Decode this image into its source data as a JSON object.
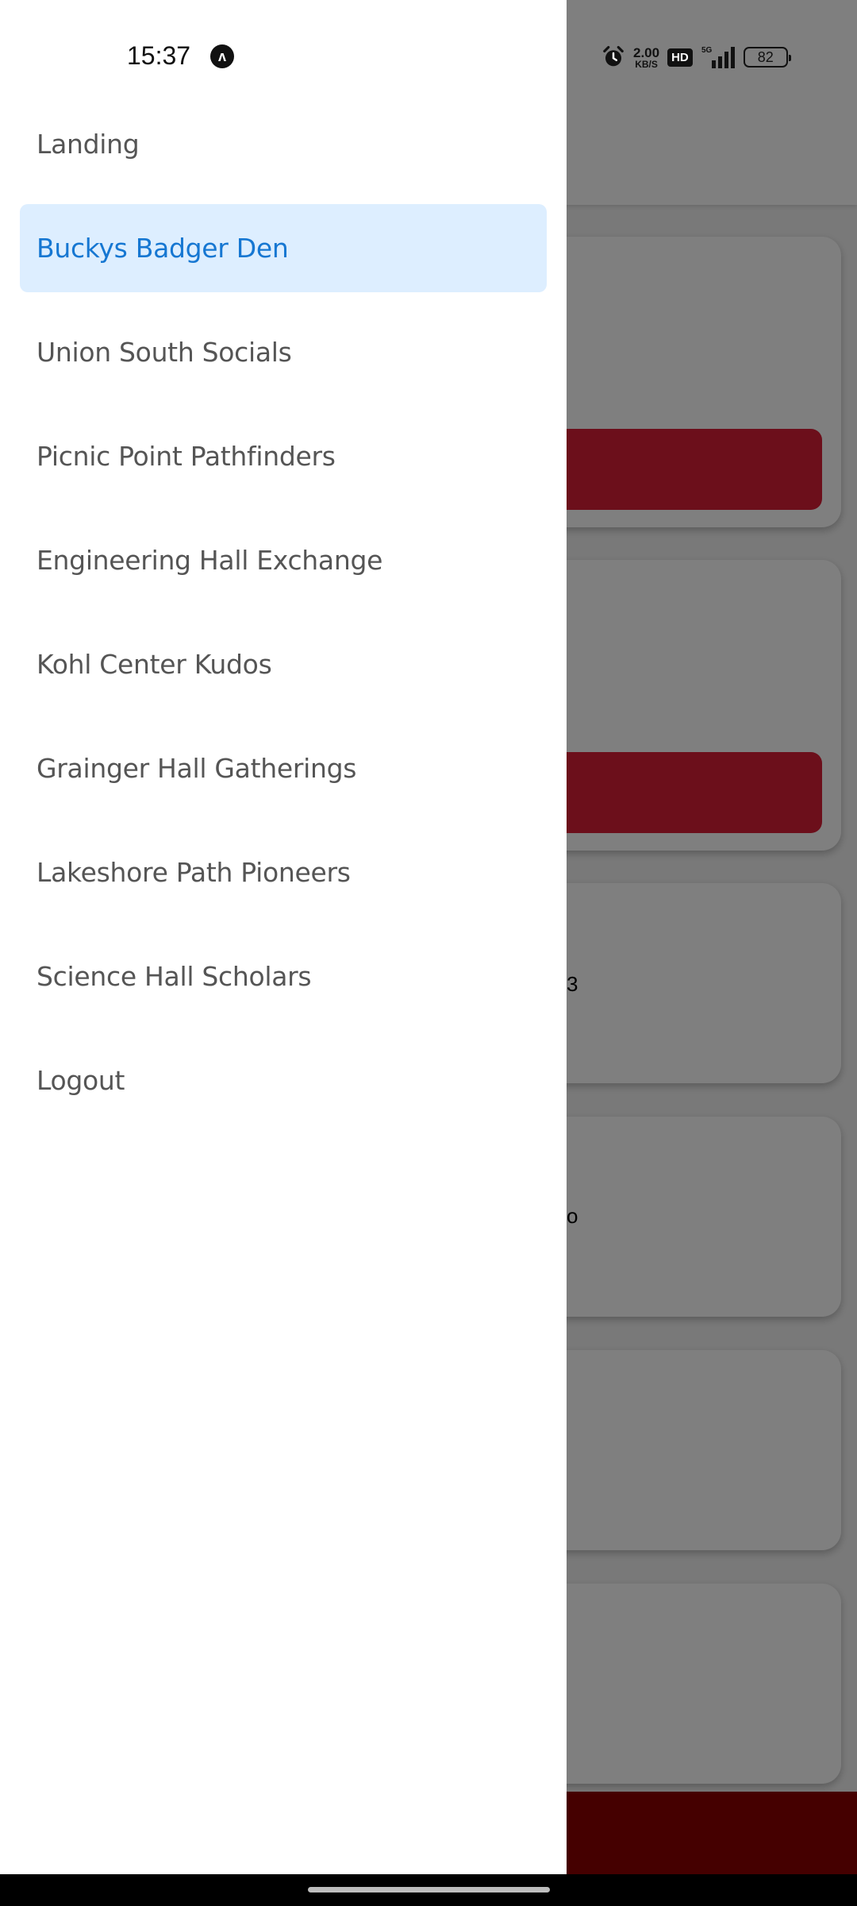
{
  "status_bar": {
    "time": "15:37",
    "app_badge": "ʌ",
    "speed_value": "2.00",
    "speed_unit": "KB/S",
    "hd_label": "HD",
    "network_label": "5G",
    "battery": "82"
  },
  "drawer": {
    "active_index": 1,
    "items": [
      {
        "label": "Landing"
      },
      {
        "label": "Buckys Badger Den"
      },
      {
        "label": "Union South Socials"
      },
      {
        "label": "Picnic Point Pathfinders"
      },
      {
        "label": "Engineering Hall Exchange"
      },
      {
        "label": "Kohl Center Kudos"
      },
      {
        "label": "Grainger Hall Gatherings"
      },
      {
        "label": "Lakeshore Path Pioneers"
      },
      {
        "label": "Science Hall Scholars"
      },
      {
        "label": "Logout"
      }
    ]
  },
  "background": {
    "card3_partial_text": "3",
    "card4_partial_text": "o"
  },
  "colors": {
    "active_bg": "#ddeeff",
    "active_text": "#1677d2",
    "item_text": "#555555",
    "brand_button": "#d81f37",
    "footer": "#8b0000"
  }
}
